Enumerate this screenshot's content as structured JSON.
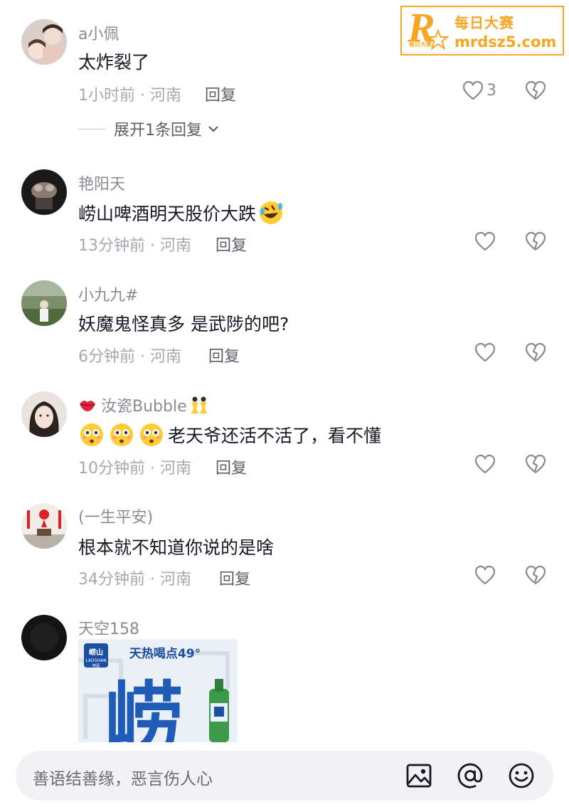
{
  "watermark": {
    "cn": "每日大赛",
    "url": "mrdsz5.com",
    "small": "每日大赛"
  },
  "comments": [
    {
      "username": "a小佩",
      "content": "太炸裂了",
      "meta": "1小时前 · 河南",
      "reply": "回复",
      "likes": "3",
      "expand": "展开1条回复"
    },
    {
      "username": "艳阳天",
      "content": "崂山啤酒明天股价大跌",
      "meta": "13分钟前 · 河南",
      "reply": "回复"
    },
    {
      "username": "小九九#",
      "content": "妖魔鬼怪真多 是武陟的吧?",
      "meta": "6分钟前 · 河南",
      "reply": "回复"
    },
    {
      "username": "汝瓷Bubble",
      "content": "老天爷还活不活了，看不懂",
      "meta": "10分钟前 · 河南",
      "reply": "回复"
    },
    {
      "username": "(一生平安)",
      "content": "根本就不知道你说的是啥",
      "meta": "34分钟前 · 河南",
      "reply": "回复"
    },
    {
      "username": "天空158",
      "image": {
        "brand": "崂山",
        "brand_en": "LAOSHAN",
        "brand_sub": "啤酒",
        "slogan": "天热喝点49°",
        "big_char": "崂"
      }
    }
  ],
  "input": {
    "placeholder": "善语结善缘，恶言伤人心"
  },
  "icons": [
    "image-icon",
    "at-icon",
    "emoji-icon",
    "heart-icon",
    "broken-heart-icon",
    "chevron-down-icon"
  ]
}
